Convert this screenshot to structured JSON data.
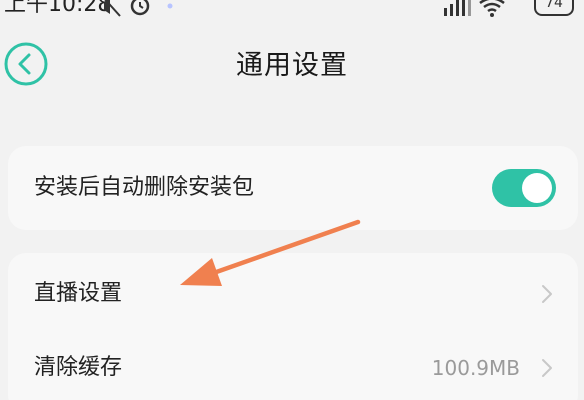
{
  "status_bar": {
    "time": "上午10:28",
    "battery": "74"
  },
  "header": {
    "title": "通用设置"
  },
  "settings": {
    "auto_delete": {
      "label": "安装后自动删除安装包",
      "enabled": true
    },
    "live_settings": {
      "label": "直播设置"
    },
    "clear_cache": {
      "label": "清除缓存",
      "value": "100.9MB"
    }
  },
  "colors": {
    "toggle_on": "#2fc2a6",
    "back_button": "#2fc2a6",
    "annotation_arrow": "#f0804f"
  },
  "icons": {
    "back": "chevron-left-circle-icon",
    "chevron": "chevron-right-icon",
    "wifi": "wifi-icon",
    "signal": "signal-icon",
    "alarm": "alarm-icon",
    "mute": "mute-icon"
  }
}
